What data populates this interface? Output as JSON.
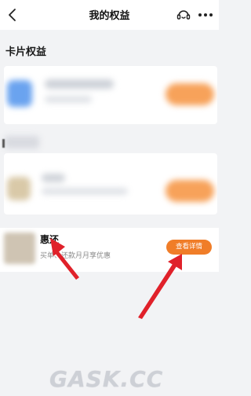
{
  "header": {
    "title": "我的权益",
    "back_icon": "chevron-left-icon",
    "support_icon": "customer-service-icon",
    "more_icon": "more-dots-icon"
  },
  "section": {
    "title": "卡片权益"
  },
  "benefit": {
    "name": "惠还",
    "description": "买单、还款月月享优惠",
    "detail_button": "查看详情"
  },
  "watermark": "GASK.CC",
  "colors": {
    "accent_orange": "#f07d28",
    "arrow_red": "#e0212a",
    "background": "#f2f3f5"
  }
}
